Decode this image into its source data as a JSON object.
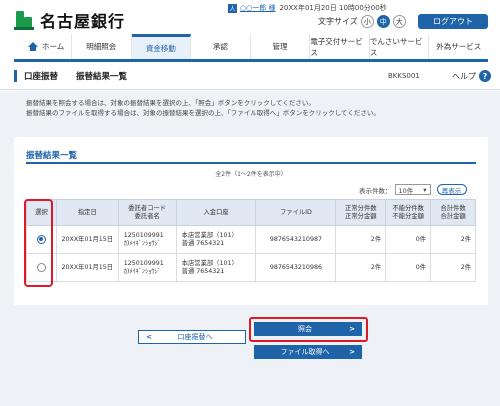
{
  "header": {
    "bank_name": "名古屋銀行",
    "user_icon": "user-icon",
    "user_name": "○○一郎 様",
    "last_login": "20XX年01月20日 10時00分00秒",
    "font_size_label": "文字サイズ",
    "font_sizes": [
      "小",
      "中",
      "大"
    ],
    "font_size_selected": "中",
    "logout_label": "ログアウト"
  },
  "nav": {
    "items": [
      {
        "label": "ホーム",
        "icon": "home-icon"
      },
      {
        "label": "明細照会"
      },
      {
        "label": "資金移動",
        "active": true
      },
      {
        "label": "承認"
      },
      {
        "label": "管理"
      },
      {
        "label": "電子交付サービス"
      },
      {
        "label": "でんさいサービス"
      },
      {
        "label": "外為サービス"
      }
    ]
  },
  "title_bar": {
    "category": "口座振替",
    "title": "振替結果一覧",
    "screen_id": "BKKS001",
    "help_label": "ヘルプ",
    "help_icon": "?"
  },
  "instructions": [
    "振替結果を照会する場合は、対象の振替結果を選択の上、「照会」ボタンをクリックしてください。",
    "振替結果のファイルを取得する場合は、対象の振替結果を選択の上、「ファイル取得へ」ボタンをクリックしてください。"
  ],
  "results": {
    "section_title": "振替結果一覧",
    "count_text": "全2件（1〜2件を表示中）",
    "display_count_label": "表示件数：",
    "display_count_value": "10件",
    "redisplay_label": "再表示",
    "columns": {
      "select": "選択",
      "date": "指定日",
      "client_code": "委託者コード",
      "client_name": "委託者名",
      "account": "入金口座",
      "file_id": "ファイルID",
      "normal_count": "正常分件数",
      "normal_amount": "正常分金額",
      "unpaid_count": "不能分件数",
      "unpaid_amount": "不能分金額",
      "total_count": "合計件数",
      "total_amount": "合計金額"
    },
    "rows": [
      {
        "selected": true,
        "date": "20XX年01月15日",
        "client_code": "1250109991",
        "client_name": "ｶ)ﾒｲｷﾞﾝｼｮｳｼﾞ",
        "account_branch": "本店営業部（101）",
        "account_number": "普通 7654321",
        "file_id": "9876543210987",
        "normal": "2件",
        "unpaid": "0件",
        "total": "2件"
      },
      {
        "selected": false,
        "date": "20XX年01月15日",
        "client_code": "1250109991",
        "client_name": "ｶ)ﾒｲｷﾞﾝｼｮｳｼﾞ",
        "account_branch": "本店営業部（101）",
        "account_number": "普通 7654321",
        "file_id": "9876543210986",
        "normal": "2件",
        "unpaid": "0件",
        "total": "2件"
      }
    ]
  },
  "buttons": {
    "back": "口座振替へ",
    "confirm": "照会",
    "file": "ファイル取得へ"
  },
  "colors": {
    "primary": "#1f63a8",
    "highlight": "#e0192a",
    "brand_green": "#1a9a4a"
  }
}
